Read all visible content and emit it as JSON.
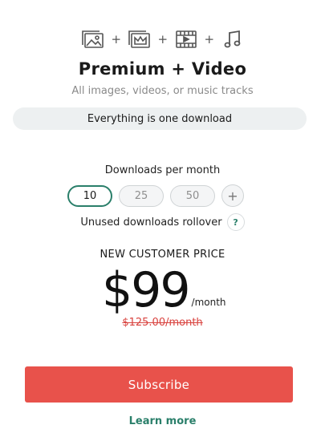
{
  "plan": {
    "icons": [
      "image-icon",
      "crown-image-icon",
      "video-icon",
      "music-icon"
    ],
    "title": "Premium + Video",
    "subtitle": "All images, videos, or music tracks",
    "pill_text": "Everything is one download"
  },
  "downloads": {
    "label": "Downloads per month",
    "options": [
      "10",
      "25",
      "50"
    ],
    "selected": "10",
    "plus_label": "+",
    "rollover_text": "Unused downloads rollover",
    "help_label": "?"
  },
  "pricing": {
    "label": "NEW CUSTOMER PRICE",
    "amount": "$99",
    "period": "/month",
    "original": "$125.00/month"
  },
  "actions": {
    "subscribe_label": "Subscribe",
    "learn_more_label": "Learn more"
  },
  "colors": {
    "accent_green": "#2a7f6a",
    "subscribe_red": "#e8524b",
    "strike_red": "#d9433f",
    "pill_bg": "#edf0f1"
  },
  "plus_sign": "+"
}
